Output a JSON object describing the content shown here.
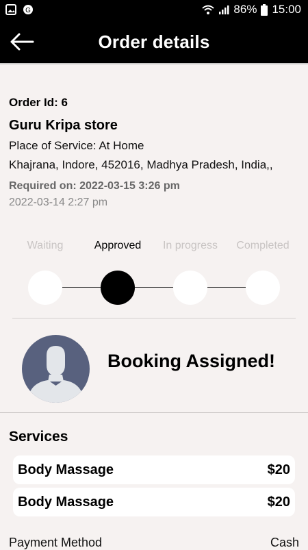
{
  "status_bar": {
    "battery": "86%",
    "time": "15:00"
  },
  "app_bar": {
    "title": "Order details"
  },
  "order": {
    "id_text": "Order Id: 6",
    "store_name": "Guru Kripa store",
    "place_of_service": "Place of Service: At Home",
    "address": "Khajrana, Indore, 452016, Madhya Pradesh, India,,",
    "required_on": "Required on: 2022-03-15 3:26 pm",
    "created_at": "2022-03-14 2:27 pm"
  },
  "progress": {
    "steps": [
      {
        "label": "Waiting",
        "active": false
      },
      {
        "label": "Approved",
        "active": true
      },
      {
        "label": "In progress",
        "active": false
      },
      {
        "label": "Completed",
        "active": false
      }
    ]
  },
  "booking": {
    "status_text": "Booking Assigned!"
  },
  "services": {
    "title": "Services",
    "items": [
      {
        "name": "Body Massage",
        "price": "$20"
      },
      {
        "name": "Body Massage",
        "price": "$20"
      }
    ]
  },
  "payment": {
    "label": "Payment Method",
    "value": "Cash"
  },
  "colors": {
    "background": "#f6f2f1",
    "bar": "#000000",
    "avatar": "#58617e",
    "inactive_step": "#c8c4c3"
  }
}
